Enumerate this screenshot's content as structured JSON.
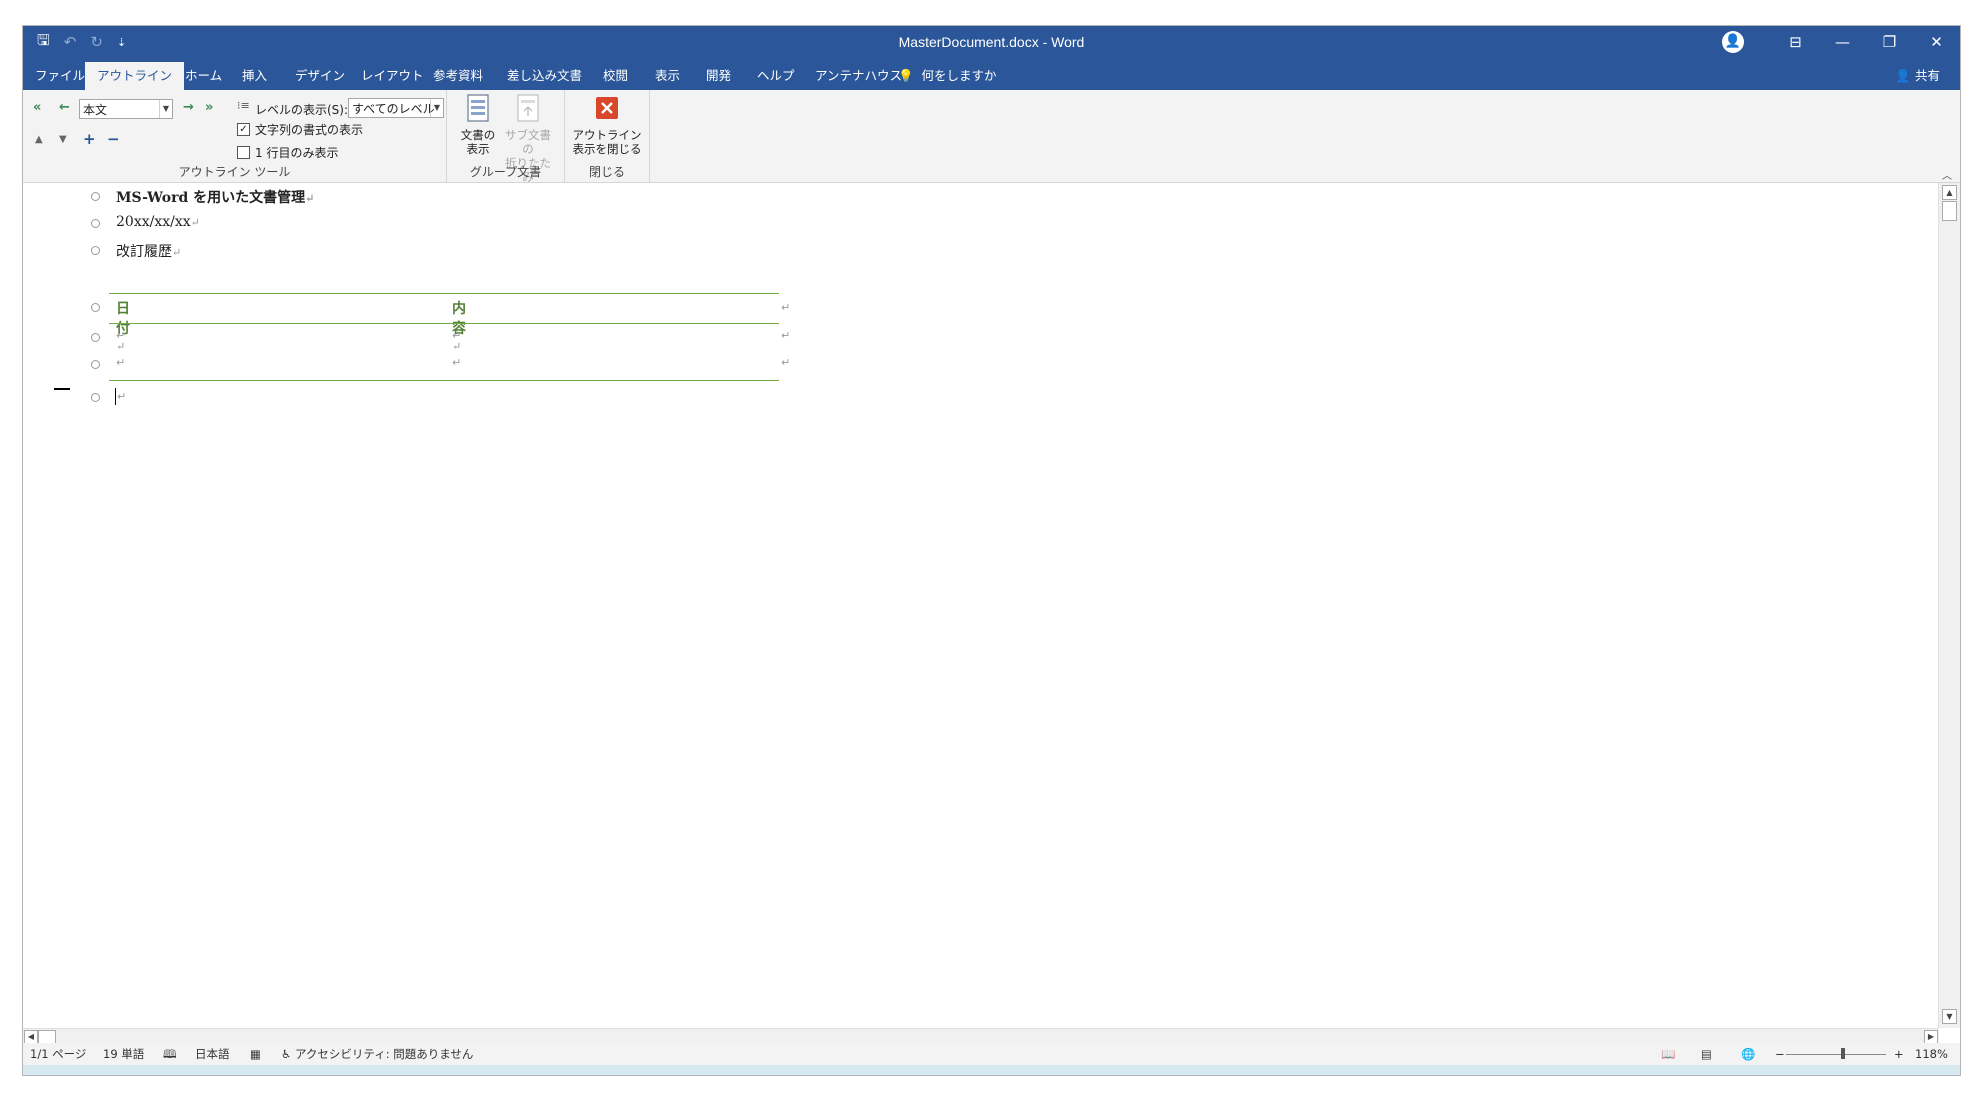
{
  "window": {
    "title": "MasterDocument.docx  -  Word",
    "qat": {
      "save": "🖫",
      "undo": "↶",
      "redo": "↻",
      "customize": "⇣"
    },
    "controls": {
      "avatar": "👤",
      "ribbon_display": "⊟",
      "minimize": "—",
      "restore": "❐",
      "close": "✕"
    }
  },
  "tabs": [
    "ファイル",
    "アウトライン",
    "ホーム",
    "挿入",
    "デザイン",
    "レイアウト",
    "参考資料",
    "差し込み文書",
    "校閲",
    "表示",
    "開発",
    "ヘルプ",
    "アンテナハウス"
  ],
  "active_tab": "アウトライン",
  "tell_me": "何をしますか",
  "share": "共有",
  "ribbon": {
    "outline_tools": {
      "label": "アウトライン ツール",
      "level_value": "本文",
      "show_level_label": "レベルの表示(S):",
      "show_level_value": "すべてのレベル",
      "show_text_format": "文字列の書式の表示",
      "show_text_format_checked": true,
      "show_first_line": "1 行目のみ表示",
      "show_first_line_checked": false
    },
    "master_document": {
      "label": "グループ文書",
      "show_document": "文書の\n表示",
      "collapse_subdocs": "サブ文書の\n折りたたみ"
    },
    "close": {
      "label": "閉じる",
      "close_outline": "アウトライン\n表示を閉じる"
    }
  },
  "document": {
    "lines": [
      {
        "text": "MS-Word を用いた文書管理",
        "bold": true
      },
      {
        "text": "20xx/xx/xx",
        "bold": false
      },
      {
        "text": "改訂履歴",
        "bold": false
      }
    ],
    "table": {
      "headers": [
        "日付",
        "内容"
      ],
      "rows": [
        [
          "",
          ""
        ],
        [
          "",
          ""
        ]
      ]
    },
    "paragraph_mark": "↵"
  },
  "status": {
    "page": "1/1 ページ",
    "words": "19 単語",
    "language": "日本語",
    "accessibility": "アクセシビリティ: 問題ありません",
    "zoom": "118%"
  },
  "colors": {
    "title_bar": "#2b579a",
    "table_accent": "#70ad47",
    "table_header_text": "#538135",
    "close_icon": "#d9472b"
  }
}
